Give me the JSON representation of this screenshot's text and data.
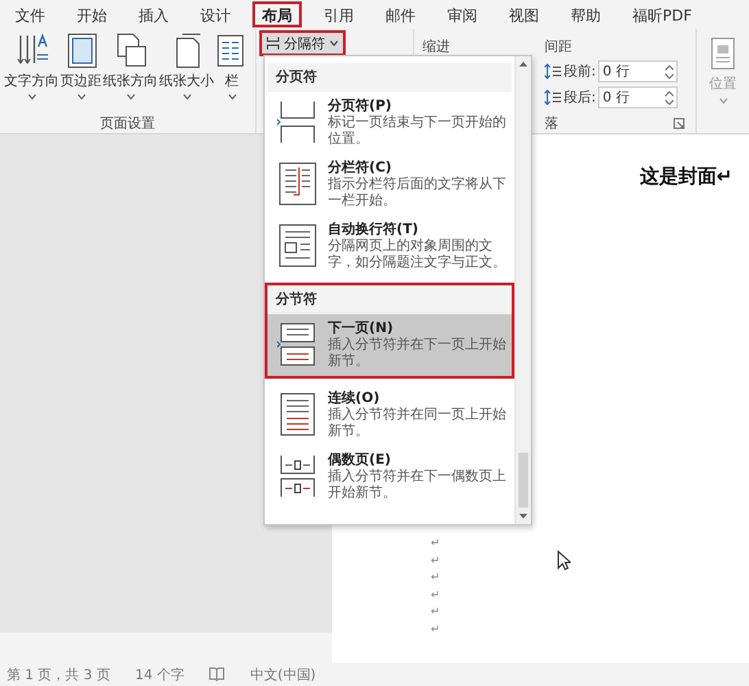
{
  "menu_tabs": [
    {
      "label": "文件",
      "selected": false
    },
    {
      "label": "开始",
      "selected": false
    },
    {
      "label": "插入",
      "selected": false
    },
    {
      "label": "设计",
      "selected": false
    },
    {
      "label": "布局",
      "selected": true
    },
    {
      "label": "引用",
      "selected": false
    },
    {
      "label": "邮件",
      "selected": false
    },
    {
      "label": "审阅",
      "selected": false
    },
    {
      "label": "视图",
      "selected": false
    },
    {
      "label": "帮助",
      "selected": false
    },
    {
      "label": "福昕PDF",
      "selected": false
    }
  ],
  "ribbon": {
    "page_setup": {
      "buttons": [
        {
          "label": "文字方向",
          "kind": "text_direction"
        },
        {
          "label": "页边距",
          "kind": "margins"
        },
        {
          "label": "纸张方向",
          "kind": "orientation"
        },
        {
          "label": "纸张大小",
          "kind": "size"
        },
        {
          "label": "栏",
          "kind": "columns"
        }
      ],
      "group_label": "页面设置"
    },
    "breaks_button": {
      "label": "分隔符",
      "pressed": true
    },
    "indent_label": "缩进",
    "spacing_label": "间距",
    "spacing_fields": [
      {
        "label": "段前:",
        "value": "0 行"
      },
      {
        "label": "段后:",
        "value": "0 行"
      }
    ],
    "paragraph_group_label": "落",
    "position_button": {
      "label": "位置",
      "disabled": true
    }
  },
  "dropdown": {
    "sections": [
      {
        "heading": "分页符",
        "highlighted": false,
        "items": [
          {
            "kind": "page_break",
            "title": "分页符(P)",
            "description": "标记一页结束与下一页开始的位置。",
            "selected": false
          },
          {
            "kind": "column_break",
            "title": "分栏符(C)",
            "description": "指示分栏符后面的文字将从下一栏开始。",
            "selected": false
          },
          {
            "kind": "text_wrapping",
            "title": "自动换行符(T)",
            "description": "分隔网页上的对象周围的文字，如分隔题注文字与正文。",
            "selected": false
          }
        ]
      },
      {
        "heading": "分节符",
        "highlighted": true,
        "items": [
          {
            "kind": "next_page",
            "title": "下一页(N)",
            "description": "插入分节符并在下一页上开始新节。",
            "selected": true
          }
        ]
      },
      {
        "highlighted": false,
        "items": [
          {
            "kind": "continuous",
            "title": "连续(O)",
            "description": "插入分节符并在同一页上开始新节。",
            "selected": false
          },
          {
            "kind": "even_page",
            "title": "偶数页(E)",
            "description": "插入分节符并在下一偶数页上开始新节。",
            "selected": false
          }
        ]
      }
    ]
  },
  "document": {
    "heading": "这是封面↵",
    "paragraph_marks": [
      "↵",
      "↵",
      "↵",
      "↵",
      "↵",
      "↵"
    ]
  },
  "status_bar": {
    "page": "第 1 页，共 3 页",
    "words": "14 个字",
    "language": "中文(中国)"
  }
}
